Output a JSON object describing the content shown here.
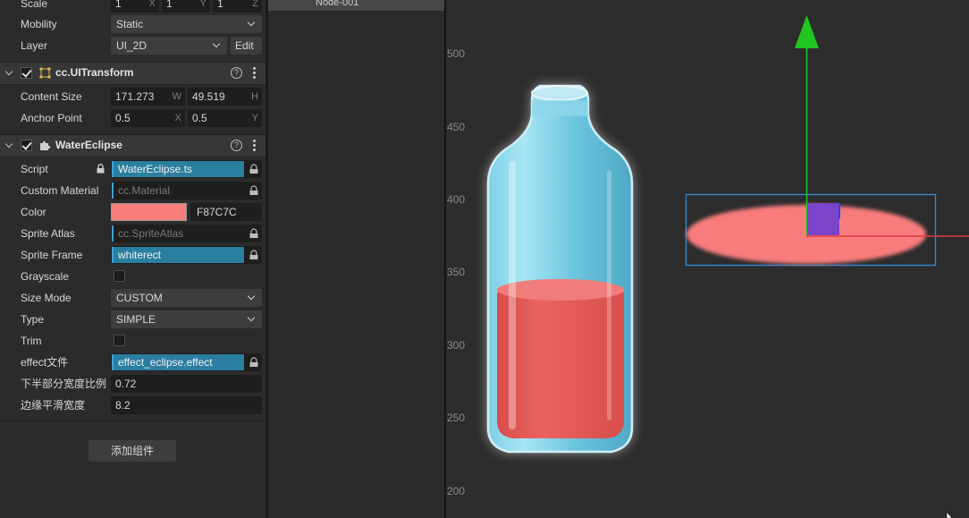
{
  "inspector": {
    "scale": {
      "label": "Scale",
      "x": "1",
      "y": "1",
      "z": "1",
      "x_unit": "X",
      "y_unit": "Y",
      "z_unit": "Z"
    },
    "mobility": {
      "label": "Mobility",
      "value": "Static"
    },
    "layer": {
      "label": "Layer",
      "value": "UI_2D",
      "edit_label": "Edit"
    },
    "ui_transform": {
      "title": "cc.UITransform",
      "content_size": {
        "label": "Content Size",
        "w": "171.273",
        "h": "49.519",
        "w_unit": "W",
        "h_unit": "H"
      },
      "anchor_point": {
        "label": "Anchor Point",
        "x": "0.5",
        "y": "0.5",
        "x_unit": "X",
        "y_unit": "Y"
      }
    },
    "water_eclipse": {
      "title": "WaterEclipse",
      "script": {
        "label": "Script",
        "value": "WaterEclipse.ts"
      },
      "custom_material": {
        "label": "Custom Material",
        "placeholder": "cc.Material"
      },
      "color": {
        "label": "Color",
        "hex": "F87C7C",
        "swatch": "#f87c7c"
      },
      "sprite_atlas": {
        "label": "Sprite Atlas",
        "placeholder": "cc.SpriteAtlas"
      },
      "sprite_frame": {
        "label": "Sprite Frame",
        "value": "whiterect"
      },
      "grayscale": {
        "label": "Grayscale",
        "checked": false
      },
      "size_mode": {
        "label": "Size Mode",
        "value": "CUSTOM"
      },
      "type": {
        "label": "Type",
        "value": "SIMPLE"
      },
      "trim": {
        "label": "Trim",
        "checked": false
      },
      "effect_file": {
        "label": "effect文件",
        "value": "effect_eclipse.effect"
      },
      "lower_half_ratio": {
        "label": "下半部分宽度比例",
        "value": "0.72"
      },
      "edge_smooth_width": {
        "label": "边缘平滑宽度",
        "value": "8.2"
      }
    },
    "add_component_label": "添加组件"
  },
  "hierarchy": {
    "selected_node": "Node-001"
  },
  "scene": {
    "y_ticks": [
      "500",
      "450",
      "400",
      "350",
      "300",
      "250",
      "200"
    ],
    "colors": {
      "bottle_liquid": "#e65a58",
      "ellipse": "#f87c7c",
      "gizmo_y": "#22c922",
      "gizmo_x": "#e23a3a",
      "selection": "#2f8ed8"
    }
  }
}
